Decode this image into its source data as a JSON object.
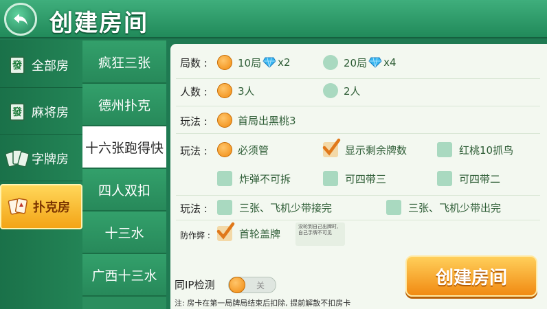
{
  "header": {
    "title": "创建房间"
  },
  "categories": [
    {
      "label": "全部房",
      "icon": "mahjong-tile-icon"
    },
    {
      "label": "麻将房",
      "icon": "mahjong-tile-icon"
    },
    {
      "label": "字牌房",
      "icon": "word-cards-icon"
    },
    {
      "label": "扑克房",
      "icon": "poker-cards-icon"
    }
  ],
  "tile_glyph": "發",
  "games": [
    "疯狂三张",
    "德州扑克",
    "十六张跑得快",
    "四人双扣",
    "十三水",
    "广西十三水"
  ],
  "options": {
    "rounds": {
      "label": "局数 :",
      "a": "10局",
      "a_mult": "x2",
      "b": "20局",
      "b_mult": "x4"
    },
    "players": {
      "label": "人数 :",
      "a": "3人",
      "b": "2人"
    },
    "play1": {
      "label": "玩法 :",
      "a": "首局出黑桃3"
    },
    "play2": {
      "label": "玩法 :",
      "a": "必须管",
      "b": "显示剩余牌数",
      "c": "红桃10抓鸟",
      "d": "炸弹不可拆",
      "e": "可四带三",
      "f": "可四带二"
    },
    "play3": {
      "label": "玩法 :",
      "a": "三张、飞机少带接完",
      "b": "三张、飞机少带出完"
    },
    "anti_cheat": {
      "label": "防作弊 :",
      "a": "首轮盖牌",
      "tip": "没轮到自己出牌时, 自己手牌不可见"
    }
  },
  "ip_check": {
    "label": "同IP检测",
    "state": "关"
  },
  "note": "注: 房卡在第一局牌局结束后扣除, 提前解散不扣房卡",
  "create_button": "创建房间"
}
